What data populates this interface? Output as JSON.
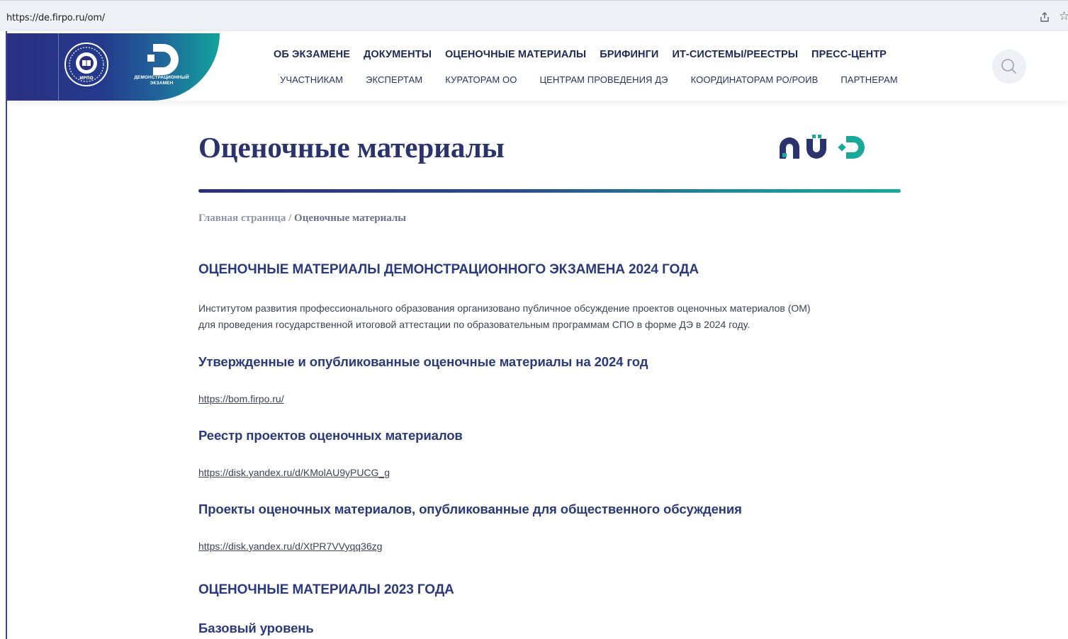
{
  "browser": {
    "url": "https://de.firpo.ru/om/"
  },
  "header": {
    "logo_caption": "ДЕМОНСТРАЦИОННЫЙ ЭКЗАМЕН",
    "emblem_text": "ИРПО",
    "nav_primary": [
      "ОБ ЭКЗАМЕНЕ",
      "ДОКУМЕНТЫ",
      "ОЦЕНОЧНЫЕ МАТЕРИАЛЫ",
      "БРИФИНГИ",
      "ИТ-СИСТЕМЫ/РЕЕСТРЫ",
      "ПРЕСС-ЦЕНТР"
    ],
    "nav_secondary": [
      "УЧАСТНИКАМ",
      "ЭКСПЕРТАМ",
      "КУРАТОРАМ ОО",
      "ЦЕНТРАМ ПРОВЕДЕНИЯ ДЭ",
      "КООРДИНАТОРАМ РО/РОИВ",
      "ПАРТНЕРАМ"
    ],
    "search_icon": "search-icon"
  },
  "page": {
    "title": "Оценочные материалы",
    "breadcrumb": {
      "home": "Главная страница",
      "separator": "/",
      "current": "Оценочные материалы"
    },
    "section_2024": {
      "heading": "ОЦЕНОЧНЫЕ МАТЕРИАЛЫ ДЕМОНСТРАЦИОННОГО ЭКЗАМЕНА 2024 ГОДА",
      "intro_line1": "Институтом развития профессионального образования организовано публичное обсуждение проектов оценочных материалов (ОМ)",
      "intro_line2": "для проведения государственной итоговой аттестации по образовательным программам СПО в форме ДЭ в 2024 году.",
      "approved_heading": "Утвержденные и опубликованные оценочные материалы на 2024 год",
      "approved_link": "https://bom.firpo.ru/",
      "registry_heading": "Реестр проектов оценочных материалов",
      "registry_link": "https://disk.yandex.ru/d/KMolAU9yPUCG_g",
      "drafts_heading": "Проекты оценочных материалов, опубликованные для общественного обсуждения",
      "drafts_link": "https://disk.yandex.ru/d/XtPR7VVyqq36zg"
    },
    "section_2023": {
      "heading": "ОЦЕНОЧНЫЕ МАТЕРИАЛЫ 2023 ГОДА",
      "basic_level": "Базовый уровень"
    }
  },
  "colors": {
    "brand_navy": "#2a336e",
    "brand_blue": "#2a3a7c",
    "brand_teal": "#18a99a",
    "text": "#3d4256"
  }
}
